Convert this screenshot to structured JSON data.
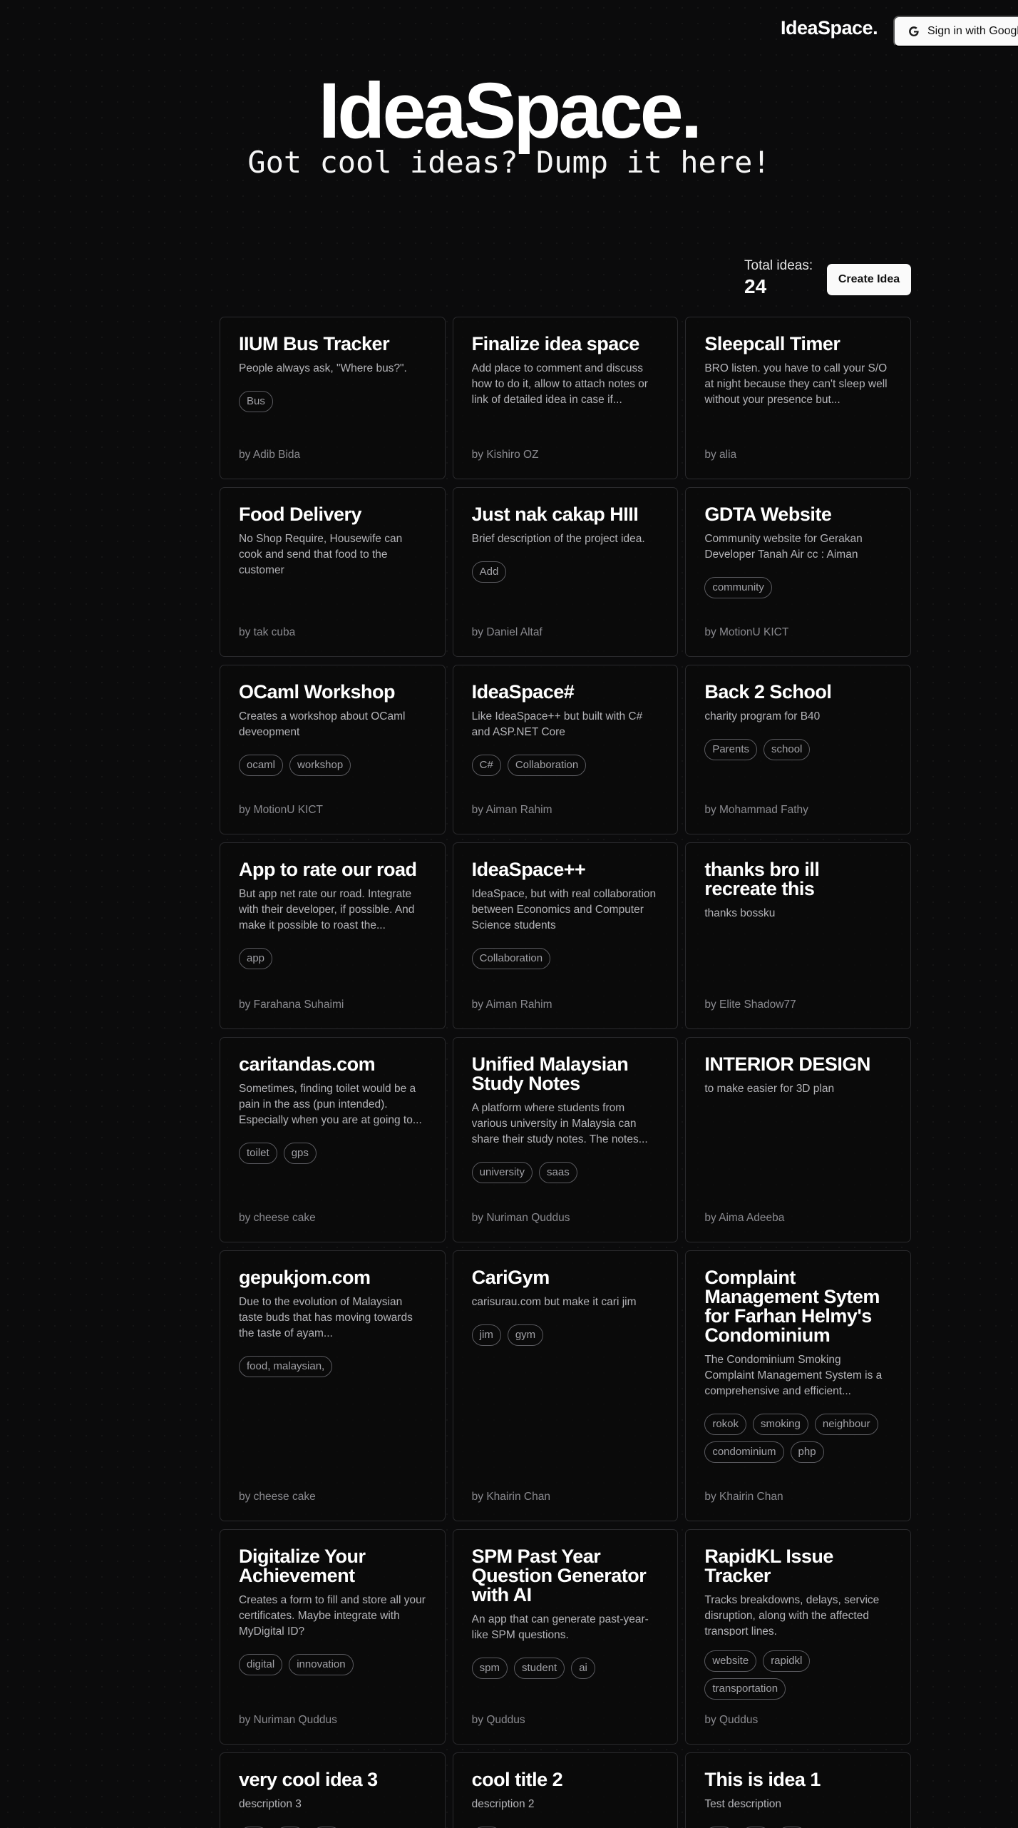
{
  "nav": {
    "brand": "IdeaSpace.",
    "signin_label": "Sign in with Google"
  },
  "hero": {
    "title": "IdeaSpace.",
    "subtitle": "Got cool ideas? Dump it here!"
  },
  "stats": {
    "label": "Total ideas:",
    "value": "24"
  },
  "create_label": "Create Idea",
  "ideas": [
    {
      "title": "IIUM Bus Tracker",
      "desc": "People always ask, \"Where bus?\".",
      "tags": [
        "Bus"
      ],
      "author": "by Adib Bida"
    },
    {
      "title": "Finalize idea space",
      "desc": "Add place to comment and discuss how to do it, allow to attach notes or link of detailed idea in case if...",
      "tags": [],
      "author": "by Kishiro OZ"
    },
    {
      "title": "Sleepcall Timer",
      "desc": "BRO listen. you have to call your S/O at night because they can't sleep well without your presence but...",
      "tags": [],
      "author": "by alia"
    },
    {
      "title": "Food Delivery",
      "desc": "No Shop Require, Housewife can cook and send that food to the customer",
      "tags": [],
      "author": "by tak cuba"
    },
    {
      "title": "Just nak cakap HIII",
      "desc": "Brief description of the project idea.",
      "tags": [
        "Add"
      ],
      "author": "by Daniel Altaf"
    },
    {
      "title": "GDTA Website",
      "desc": "Community website for Gerakan Developer Tanah Air cc : Aiman",
      "tags": [
        "community"
      ],
      "author": "by MotionU KICT"
    },
    {
      "title": "OCaml Workshop",
      "desc": "Creates a workshop about OCaml deveopment",
      "tags": [
        "ocaml",
        "workshop"
      ],
      "author": "by MotionU KICT"
    },
    {
      "title": "IdeaSpace#",
      "desc": "Like IdeaSpace++ but built with C# and ASP.NET Core",
      "tags": [
        "C#",
        "Collaboration"
      ],
      "author": "by Aiman Rahim"
    },
    {
      "title": "Back 2 School",
      "desc": "charity program for B40",
      "tags": [
        "Parents",
        "school"
      ],
      "author": "by Mohammad Fathy"
    },
    {
      "title": "App to rate our road",
      "desc": "But app net rate our road. Integrate with their developer, if possible. And make it possible to roast the...",
      "tags": [
        "app"
      ],
      "author": "by Farahana Suhaimi"
    },
    {
      "title": "IdeaSpace++",
      "desc": "IdeaSpace, but with real collaboration between Economics and Computer Science students",
      "tags": [
        "Collaboration"
      ],
      "author": "by Aiman Rahim"
    },
    {
      "title": "thanks bro ill recreate this",
      "desc": "thanks bossku",
      "tags": [],
      "author": "by Elite Shadow77"
    },
    {
      "title": "caritandas.com",
      "desc": "Sometimes, finding toilet would be a pain in the ass (pun intended). Especially when you are at going to...",
      "tags": [
        "toilet",
        "gps"
      ],
      "author": "by cheese cake"
    },
    {
      "title": "Unified Malaysian Study Notes",
      "desc": "A platform where students from various university in Malaysia can share their study notes. The notes...",
      "tags": [
        "university",
        "saas"
      ],
      "author": "by Nuriman Quddus"
    },
    {
      "title": "INTERIOR DESIGN",
      "desc": "to make easier for 3D plan",
      "tags": [],
      "author": "by Aima Adeeba"
    },
    {
      "title": "gepukjom.com",
      "desc": "Due to the evolution of Malaysian taste buds that has moving towards the taste of ayam...",
      "tags": [
        "food, malaysian,"
      ],
      "author": "by cheese cake"
    },
    {
      "title": "CariGym",
      "desc": "carisurau.com but make it cari jim",
      "tags": [
        "jim",
        "gym"
      ],
      "author": "by Khairin Chan"
    },
    {
      "title": "Complaint Management Sytem for Farhan Helmy's Condominium",
      "desc": "The Condominium Smoking Complaint Management System is a comprehensive and efficient...",
      "tags": [
        "rokok",
        "smoking",
        "neighbour",
        "condominium",
        "php"
      ],
      "author": "by Khairin Chan"
    },
    {
      "title": "Digitalize Your Achievement",
      "desc": "Creates a form to fill and store all your certificates. Maybe integrate with MyDigital ID?",
      "tags": [
        "digital",
        "innovation"
      ],
      "author": "by Nuriman Quddus"
    },
    {
      "title": "SPM Past Year Question Generator with AI",
      "desc": "An app that can generate past-year-like SPM questions.",
      "tags": [
        "spm",
        "student",
        "ai"
      ],
      "author": "by Quddus"
    },
    {
      "title": "RapidKL Issue Tracker",
      "desc": "Tracks breakdowns, delays, service disruption, along with the affected transport lines.",
      "tags": [
        "website",
        "rapidkl",
        "transportation"
      ],
      "author": "by Quddus"
    },
    {
      "title": "very cool idea 3",
      "desc": "description 3",
      "tags": [
        "",
        "",
        ""
      ],
      "author": ""
    },
    {
      "title": "cool title 2",
      "desc": "description 2",
      "tags": [
        ""
      ],
      "author": ""
    },
    {
      "title": "This is idea 1",
      "desc": "Test description",
      "tags": [
        "",
        "",
        ""
      ],
      "author": ""
    }
  ]
}
